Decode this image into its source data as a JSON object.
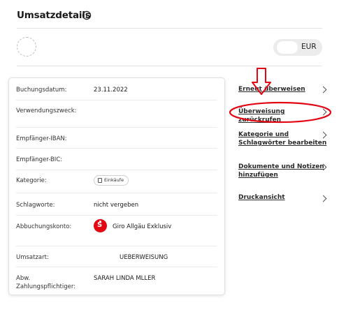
{
  "header": {
    "title": "Umsatzdetails",
    "info_icon": "info-circle-icon"
  },
  "amount": {
    "currency": "EUR",
    "value": ""
  },
  "details": {
    "booking_date": {
      "label": "Buchungsdatum:",
      "value": "23.11.2022"
    },
    "purpose": {
      "label": "Verwendungszweck:",
      "value": ""
    },
    "iban": {
      "label": "Empfänger-IBAN:",
      "value": ""
    },
    "bic": {
      "label": "Empfänger-BIC:",
      "value": ""
    },
    "category": {
      "label": "Kategorie:",
      "value": "Einkäufe",
      "icon": "shopping-bag-icon"
    },
    "keywords": {
      "label": "Schlagworte:",
      "value": "nicht vergeben"
    },
    "account": {
      "label": "Abbuchungskonto:",
      "value": "Giro Allgäu Exklusiv",
      "icon": "sparkasse-logo-icon"
    },
    "type": {
      "label": "Umsatzart:",
      "value": "UEBERWEISUNG"
    },
    "payer": {
      "label_line1": "Abw.",
      "label_line2": "Zahlungspflichtiger:",
      "value": "SARAH LINDA MLLER"
    }
  },
  "actions": [
    {
      "label": "Erneut überweisen"
    },
    {
      "label": "Überweisung zurückrufen"
    },
    {
      "label_line1": "Kategorie und",
      "label_line2": "Schlagwörter bearbeiten"
    },
    {
      "label_line1": "Dokumente und Notizen",
      "label_line2": "hinzufügen"
    },
    {
      "label": "Druckansicht"
    }
  ],
  "annotation": {
    "color": "#e30613"
  },
  "colors": {
    "sparkasse_red": "#e30613",
    "text": "#1a1a1a"
  }
}
